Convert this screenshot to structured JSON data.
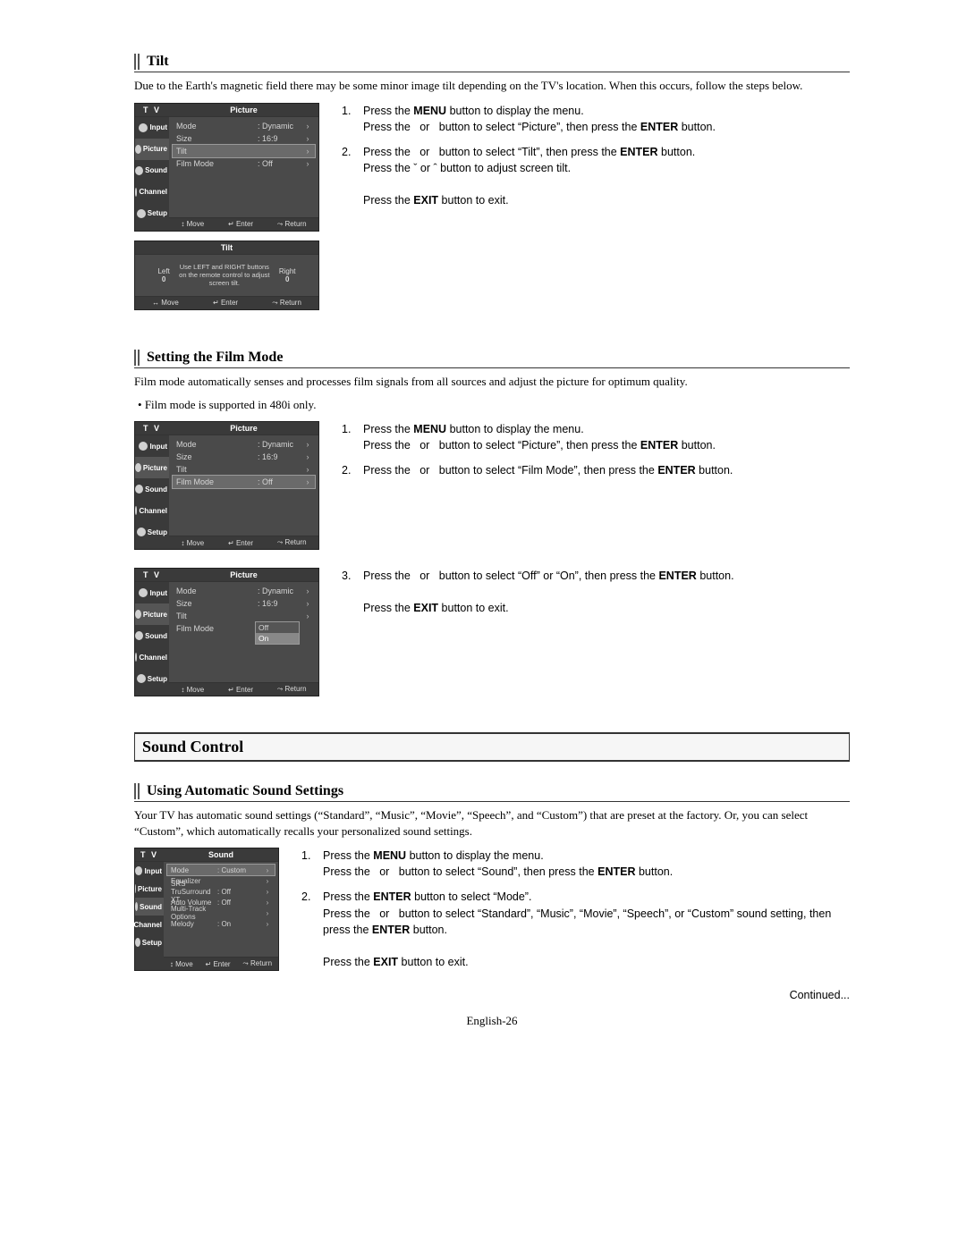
{
  "tilt": {
    "heading": "Tilt",
    "intro": "Due to the Earth's magnetic field there may be some minor image tilt depending on the TV's location. When this occurs, follow the steps below.",
    "steps": [
      "Press the MENU button to display the menu.\nPress the   or   button to select “Picture”, then press the ENTER button.",
      "Press the   or   button to select “Tilt”, then press the ENTER button.\nPress the ˇ or ˆ button to adjust screen tilt.\n\nPress the EXIT button to exit."
    ],
    "osd_picture": {
      "title": "Picture",
      "side": [
        "Input",
        "Picture",
        "Sound",
        "Channel",
        "Setup"
      ],
      "rows": [
        {
          "label": "Mode",
          "value": ": Dynamic"
        },
        {
          "label": "Size",
          "value": ": 16:9"
        },
        {
          "label": "Tilt",
          "value": "",
          "hl": true
        },
        {
          "label": "Film Mode",
          "value": ": Off"
        }
      ],
      "foot": [
        "↕ Move",
        "↵ Enter",
        "⤳ Return"
      ]
    },
    "osd_tilt": {
      "title": "Tilt",
      "left_label": "Left",
      "left_val": "0",
      "msg": "Use LEFT and RIGHT buttons on the remote control to adjust screen tilt.",
      "right_label": "Right",
      "right_val": "0",
      "foot": [
        "↔ Move",
        "↵ Enter",
        "⤳ Return"
      ]
    }
  },
  "film": {
    "heading": "Setting the Film Mode",
    "intro": "Film mode automatically senses and processes film signals from all sources and adjust the picture for optimum quality.",
    "note": "Film mode is supported in 480i only.",
    "steps12": [
      "Press the MENU button to display the menu.\nPress the   or   button to select “Picture”, then press the ENTER button.",
      "Press the   or   button to select “Film Mode”, then press the ENTER button."
    ],
    "step3": "Press the   or   button to select “Off” or “On”, then press the ENTER button.\n\nPress the EXIT button to exit.",
    "osd_a": {
      "title": "Picture",
      "side": [
        "Input",
        "Picture",
        "Sound",
        "Channel",
        "Setup"
      ],
      "rows": [
        {
          "label": "Mode",
          "value": ": Dynamic"
        },
        {
          "label": "Size",
          "value": ": 16:9"
        },
        {
          "label": "Tilt",
          "value": ""
        },
        {
          "label": "Film Mode",
          "value": ": Off",
          "hl": true
        }
      ],
      "foot": [
        "↕ Move",
        "↵ Enter",
        "⤳ Return"
      ]
    },
    "osd_b": {
      "title": "Picture",
      "side": [
        "Input",
        "Picture",
        "Sound",
        "Channel",
        "Setup"
      ],
      "rows": [
        {
          "label": "Mode",
          "value": ": Dynamic"
        },
        {
          "label": "Size",
          "value": ": 16:9"
        },
        {
          "label": "Tilt",
          "value": ""
        },
        {
          "label": "Film Mode",
          "value": ":"
        }
      ],
      "dropdown": {
        "options": [
          "Off",
          "On"
        ],
        "selected": "On"
      },
      "foot": [
        "↕ Move",
        "↵ Enter",
        "⤳ Return"
      ]
    }
  },
  "sound": {
    "title": "Sound Control",
    "sub_heading": "Using Automatic Sound Settings",
    "intro": "Your TV has automatic sound settings (“Standard”, “Music”, “Movie”, “Speech”, and “Custom”) that are preset at the factory. Or, you can select “Custom”, which automatically recalls your personalized sound settings.",
    "steps": [
      "Press the MENU button to display the menu.\nPress the   or   button to select “Sound”, then press the ENTER button.",
      "Press the ENTER button to select “Mode”.\nPress the   or   button to select “Standard”, “Music”, “Movie”, “Speech”, or “Custom” sound setting, then press the ENTER button.\n\nPress the EXIT button to exit."
    ],
    "osd": {
      "title": "Sound",
      "side": [
        "Input",
        "Picture",
        "Sound",
        "Channel",
        "Setup"
      ],
      "rows": [
        {
          "label": "Mode",
          "value": ": Custom",
          "hl": true
        },
        {
          "label": "Equalizer",
          "value": ""
        },
        {
          "label": "SRS TruSurround XT",
          "value": ": Off"
        },
        {
          "label": "Auto Volume",
          "value": ": Off"
        },
        {
          "label": "Multi-Track Options",
          "value": ""
        },
        {
          "label": "Melody",
          "value": ": On"
        }
      ],
      "foot": [
        "↕ Move",
        "↵ Enter",
        "⤳ Return"
      ]
    },
    "continued": "Continued..."
  },
  "page_num": "English-26",
  "tv_label": "T V"
}
